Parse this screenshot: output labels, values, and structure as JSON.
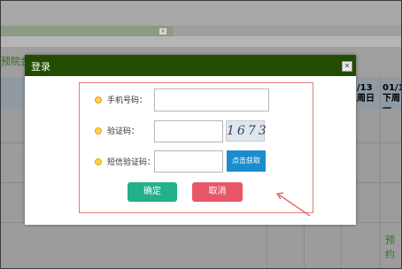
{
  "background": {
    "side_text": "预院金",
    "dates": [
      {
        "line1": "/13",
        "line2": "周日"
      },
      {
        "line1": "01/1",
        "line2": "下周一"
      }
    ],
    "green_text": "预约"
  },
  "dialog": {
    "title": "登录",
    "close_symbol": "✕",
    "phone_label": "手机号码：",
    "phone_value": "",
    "captcha_label": "验证码：",
    "captcha_value": "",
    "captcha_image_text": "1673",
    "sms_label": "短信验证码：",
    "sms_value": "",
    "sms_button": "点击获取",
    "confirm_button": "确定",
    "cancel_button": "取消"
  },
  "colors": {
    "header": "#234c00",
    "confirm": "#23b08a",
    "cancel": "#e8566a",
    "sms_button": "#1b8ccd",
    "annotation": "#e05050"
  }
}
